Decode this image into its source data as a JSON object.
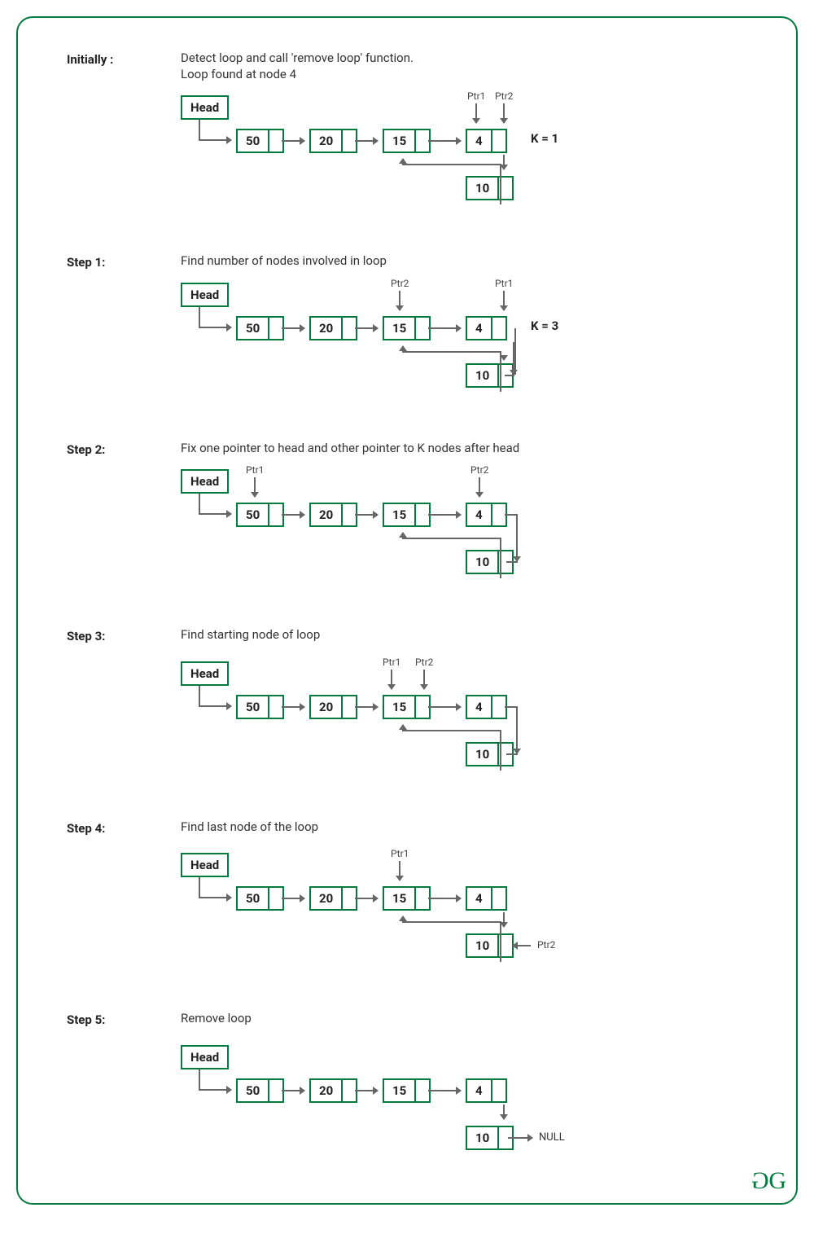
{
  "head_label": "Head",
  "null_label": "NULL",
  "logo": "GG",
  "nodes": {
    "n1": "50",
    "n2": "20",
    "n3": "15",
    "n4": "4",
    "n5": "10"
  },
  "ptr": {
    "p1": "Ptr1",
    "p2": "Ptr2"
  },
  "steps": {
    "initially": {
      "label": "Initially :",
      "desc1": "Detect loop and call 'remove loop' function.",
      "desc2": "Loop found at node 4",
      "k": "K = 1"
    },
    "s1": {
      "label": "Step 1:",
      "desc": "Find number of nodes involved in loop",
      "k": "K = 3"
    },
    "s2": {
      "label": "Step 2:",
      "desc": "Fix one pointer to head and other pointer to K nodes after head"
    },
    "s3": {
      "label": "Step 3:",
      "desc": "Find starting node of loop"
    },
    "s4": {
      "label": "Step 4:",
      "desc": "Find last node of the loop"
    },
    "s5": {
      "label": "Step 5:",
      "desc": "Remove loop"
    }
  }
}
